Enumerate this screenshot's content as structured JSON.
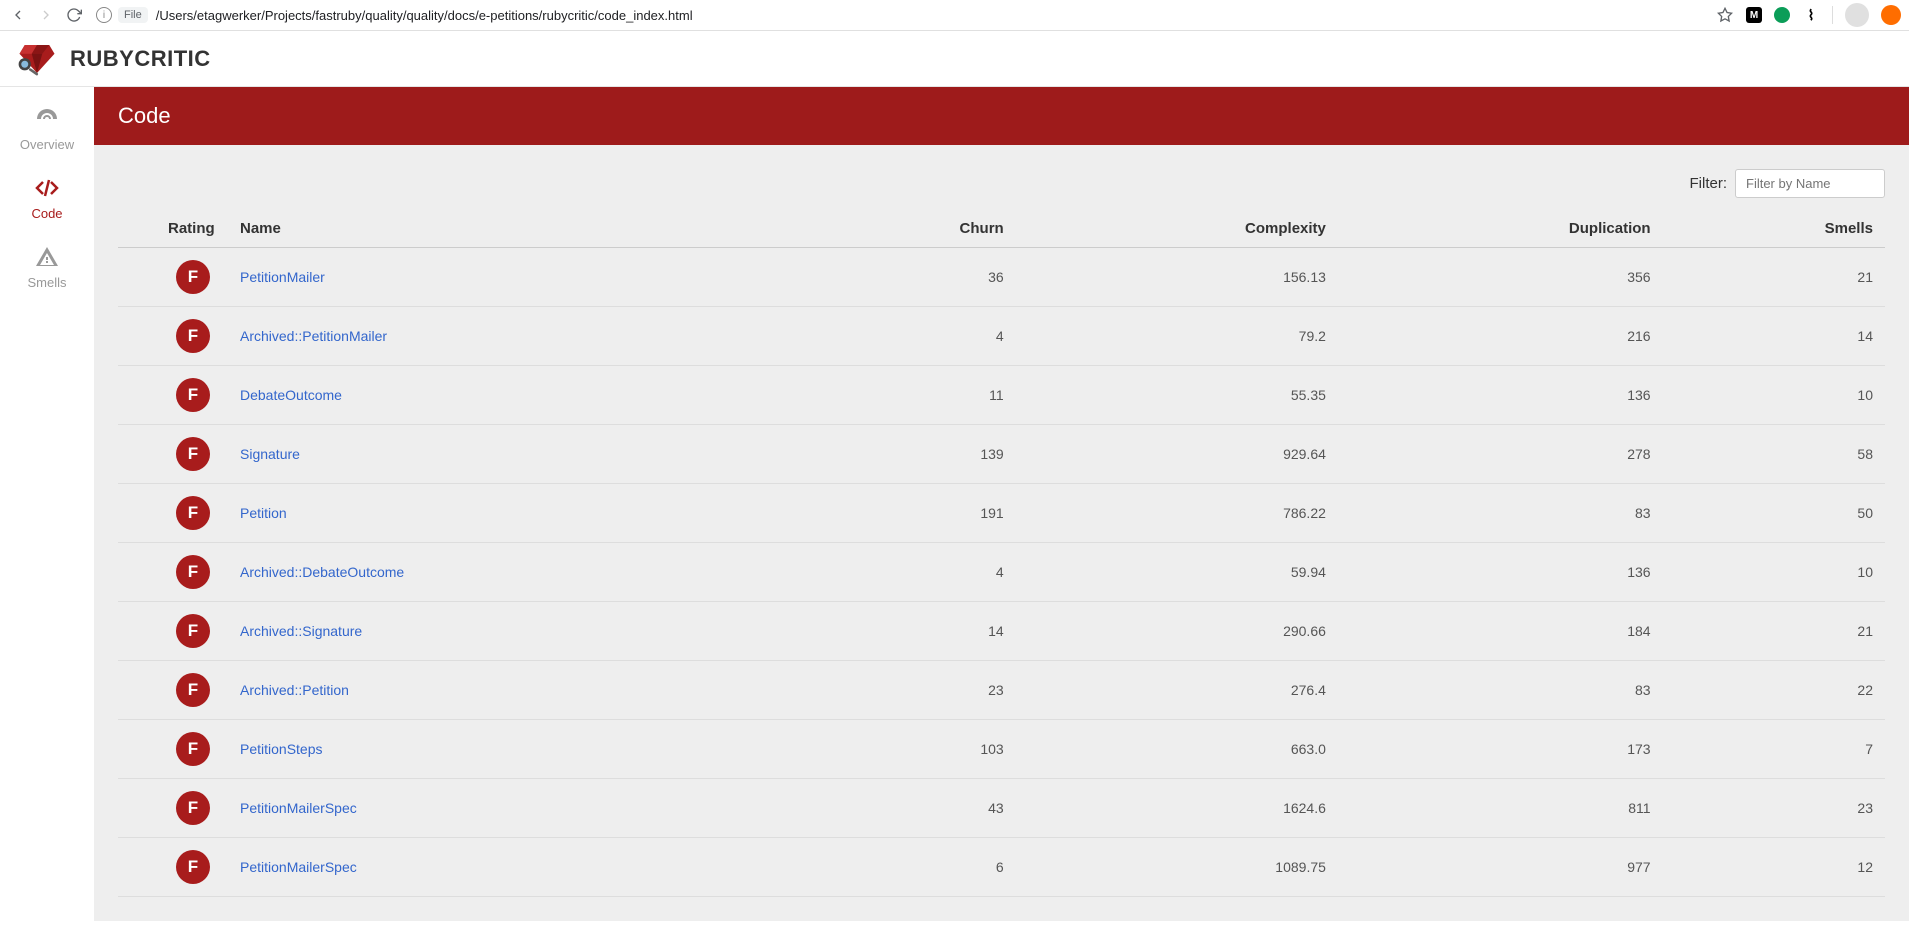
{
  "browser": {
    "file_badge": "File",
    "url": "/Users/etagwerker/Projects/fastruby/quality/quality/docs/e-petitions/rubycritic/code_index.html"
  },
  "header": {
    "app_title": "RUBYCRITIC"
  },
  "sidebar": {
    "items": [
      {
        "label": "Overview"
      },
      {
        "label": "Code"
      },
      {
        "label": "Smells"
      }
    ]
  },
  "page": {
    "title": "Code",
    "filter_label": "Filter:",
    "filter_placeholder": "Filter by Name"
  },
  "table": {
    "columns": {
      "rating": "Rating",
      "name": "Name",
      "churn": "Churn",
      "complexity": "Complexity",
      "duplication": "Duplication",
      "smells": "Smells"
    },
    "rows": [
      {
        "rating": "F",
        "name": "PetitionMailer",
        "churn": "36",
        "complexity": "156.13",
        "duplication": "356",
        "smells": "21"
      },
      {
        "rating": "F",
        "name": "Archived::PetitionMailer",
        "churn": "4",
        "complexity": "79.2",
        "duplication": "216",
        "smells": "14"
      },
      {
        "rating": "F",
        "name": "DebateOutcome",
        "churn": "11",
        "complexity": "55.35",
        "duplication": "136",
        "smells": "10"
      },
      {
        "rating": "F",
        "name": "Signature",
        "churn": "139",
        "complexity": "929.64",
        "duplication": "278",
        "smells": "58"
      },
      {
        "rating": "F",
        "name": "Petition",
        "churn": "191",
        "complexity": "786.22",
        "duplication": "83",
        "smells": "50"
      },
      {
        "rating": "F",
        "name": "Archived::DebateOutcome",
        "churn": "4",
        "complexity": "59.94",
        "duplication": "136",
        "smells": "10"
      },
      {
        "rating": "F",
        "name": "Archived::Signature",
        "churn": "14",
        "complexity": "290.66",
        "duplication": "184",
        "smells": "21"
      },
      {
        "rating": "F",
        "name": "Archived::Petition",
        "churn": "23",
        "complexity": "276.4",
        "duplication": "83",
        "smells": "22"
      },
      {
        "rating": "F",
        "name": "PetitionSteps",
        "churn": "103",
        "complexity": "663.0",
        "duplication": "173",
        "smells": "7"
      },
      {
        "rating": "F",
        "name": "PetitionMailerSpec",
        "churn": "43",
        "complexity": "1624.6",
        "duplication": "811",
        "smells": "23"
      },
      {
        "rating": "F",
        "name": "PetitionMailerSpec",
        "churn": "6",
        "complexity": "1089.75",
        "duplication": "977",
        "smells": "12"
      }
    ]
  }
}
